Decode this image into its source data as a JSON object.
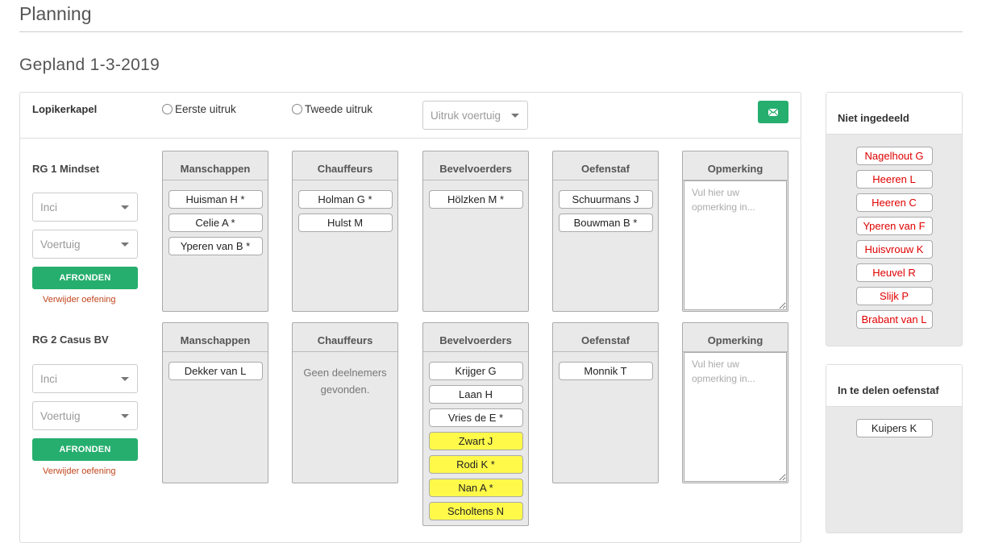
{
  "page": {
    "title": "Planning",
    "subtitle": "Gepland 1-3-2019"
  },
  "header": {
    "kazerne": "Lopikerkapel",
    "radio_first": "Eerste uitruk",
    "radio_second": "Tweede uitruk",
    "vehicle_placeholder": "Uitruk voertuig",
    "mail_icon": "envelope-icon"
  },
  "groups": [
    {
      "title": "RG 1 Mindset",
      "inci_placeholder": "Inci",
      "voertuig_placeholder": "Voertuig",
      "finish_label": "AFRONDEN",
      "delete_label": "Verwijder oefening",
      "manschappen_header": "Manschappen",
      "manschappen": [
        "Huisman H *",
        "Celie A *",
        "Yperen van B *"
      ],
      "chauffeurs_header": "Chauffeurs",
      "chauffeurs": [
        "Holman G *",
        "Hulst M"
      ],
      "chauffeurs_empty": "",
      "bevelvoerders_header": "Bevelvoerders",
      "bevelvoerders": [
        "Hölzken M *"
      ],
      "oefenstaf_header": "Oefenstaf",
      "oefenstaf": [
        "Schuurmans J",
        "Bouwman B *"
      ],
      "opmerking_header": "Opmerking",
      "opmerking_placeholder": "Vul hier uw opmerking in..."
    },
    {
      "title": "RG 2 Casus BV",
      "inci_placeholder": "Inci",
      "voertuig_placeholder": "Voertuig",
      "finish_label": "AFRONDEN",
      "delete_label": "Verwijder oefening",
      "manschappen_header": "Manschappen",
      "manschappen": [
        "Dekker van L"
      ],
      "chauffeurs_header": "Chauffeurs",
      "chauffeurs": [],
      "chauffeurs_empty": "Geen deelnemers gevonden.",
      "bevelvoerders_header": "Bevelvoerders",
      "bevelvoerders": [
        "Krijger G",
        "Laan H",
        "Vries de E *",
        "Zwart J",
        "Rodi K *",
        "Nan A *",
        "Scholtens N"
      ],
      "bevelvoerders_highlight": [
        "Zwart J",
        "Rodi K *",
        "Nan A *",
        "Scholtens N"
      ],
      "highlight_color": "#fff94a",
      "oefenstaf_header": "Oefenstaf",
      "oefenstaf": [
        "Monnik T"
      ],
      "opmerking_header": "Opmerking",
      "opmerking_placeholder": "Vul hier uw opmerking in..."
    }
  ],
  "sidebar": {
    "unassigned_title": "Niet ingedeeld",
    "unassigned": [
      "Nagelhout G",
      "Heeren L",
      "Heeren C",
      "Yperen van F",
      "Huisvrouw K",
      "Heuvel R",
      "Slijk P",
      "Brabant van L"
    ],
    "staff_title": "In te delen oefenstaf",
    "staff": [
      "Kuipers K"
    ]
  },
  "colors": {
    "accent_green": "#26ae6e",
    "unassigned_red": "#e00000",
    "delete_link": "#c0461e"
  }
}
